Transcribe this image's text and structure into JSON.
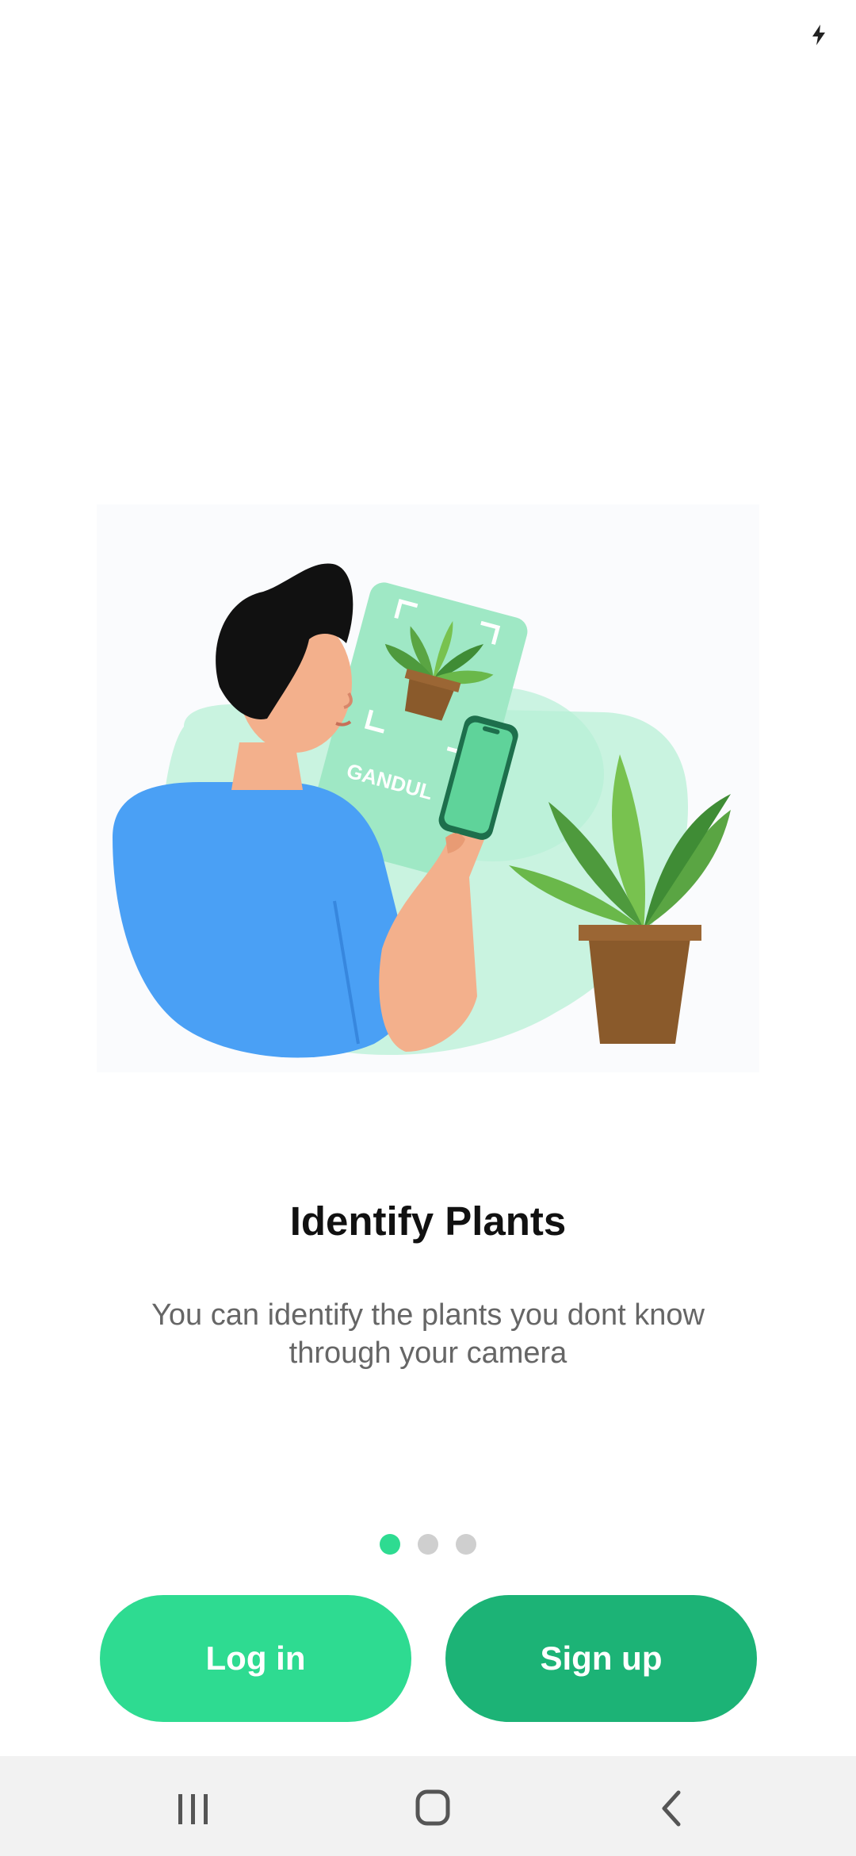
{
  "status_bar": {
    "icons": [
      "charging-icon"
    ]
  },
  "onboarding": {
    "illustration": {
      "name": "person-scanning-plant-illustration",
      "card_label": "GANDUL"
    },
    "title": "Identify Plants",
    "description": "You can identify the plants you dont know through your camera",
    "pager": {
      "count": 3,
      "active_index": 0
    }
  },
  "actions": {
    "login_label": "Log in",
    "signup_label": "Sign up"
  },
  "navigation_bar": {
    "icons": [
      "recents-icon",
      "home-icon",
      "back-icon"
    ]
  },
  "colors": {
    "primary": "#2edb91",
    "primary_dark": "#1cb376",
    "title_text": "#111111",
    "body_text": "#666666",
    "dot_inactive": "#cfcfcf",
    "nav_bar_bg": "#f2f2f2"
  }
}
